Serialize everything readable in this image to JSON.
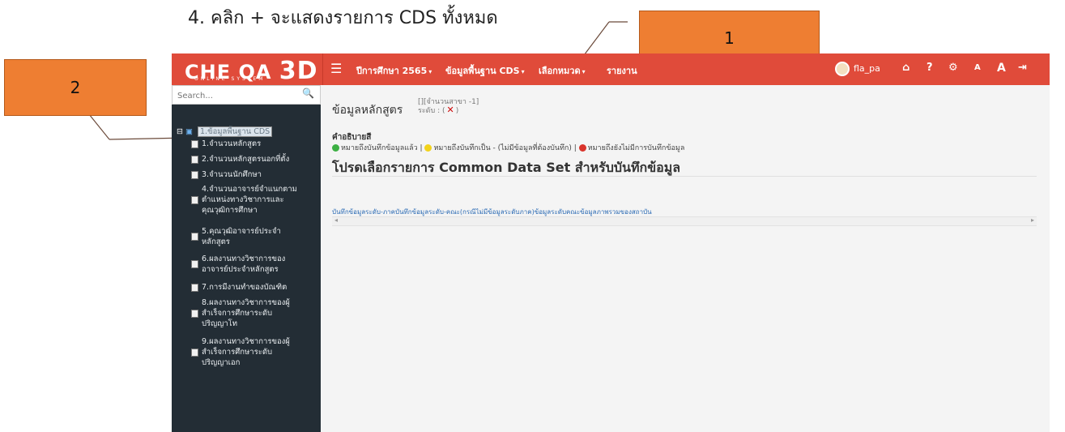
{
  "instruction": "4. คลิก + จะแสดงรายการ CDS ทั้งหมด",
  "callouts": {
    "one": "1",
    "two": "2"
  },
  "header": {
    "logo_main": "CHE QA",
    "logo_3d": "3D",
    "logo_sub": "ONLINE SYSTEM",
    "menu": {
      "year": "ปีการศึกษา 2565",
      "cds": "ข้อมูลพื้นฐาน CDS",
      "category": "เลือกหมวด",
      "report": "รายงาน"
    },
    "username": "fla_pa",
    "icons": [
      "home-icon",
      "help-icon",
      "settings-icon",
      "font-small-icon",
      "font-large-icon",
      "logout-icon"
    ]
  },
  "sidebar": {
    "search_placeholder": "Search...",
    "root_label": "1.ข้อมูลพื้นฐาน CDS",
    "items": [
      "1.จำนวนหลักสูตร",
      "2.จำนวนหลักสูตรนอกที่ตั้ง",
      "3.จำนวนนักศึกษา",
      "4.จำนวนอาจารย์จำแนกตาม\nตำแหน่งทางวิชาการและ\nคุณวุฒิการศึกษา",
      "5.คุณวุฒิอาจารย์ประจำ\nหลักสูตร",
      "6.ผลงานทางวิชาการของ\nอาจารย์ประจำหลักสูตร",
      "7.การมีงานทำของบัณฑิต",
      "8.ผลงานทางวิชาการของผู้\nสำเร็จการศึกษาระดับ\nปริญญาโท",
      "9.ผลงานทางวิชาการของผู้\nสำเร็จการศึกษาระดับ\nปริญญาเอก"
    ]
  },
  "content": {
    "title": "ข้อมูลหลักสูตร",
    "meta_count": "[][จำนวนสาขา -1]",
    "meta_level": "ระดับ : (",
    "meta_level_close": ")",
    "legend_title": "คำอธิบายสี",
    "legend_green": "หมายถึงบันทึกข้อมูลแล้ว |",
    "legend_yellow": "หมายถึงบันทึกเป็น - (ไม่มีข้อมูลที่ต้องบันทึก) |",
    "legend_red": "หมายถึงยังไม่มีการบันทึกข้อมูล",
    "heading": "โปรดเลือกรายการ Common Data Set สำหรับบันทึกข้อมูล",
    "link_row": "บันทึกข้อมูลระดับ-ภาคบันทึกข้อมูลระดับ-คณะ(กรณีไม่มีข้อมูลระดับภาค)ข้อมูลระดับคณะข้อมูลภาพรวมของสถาบัน"
  },
  "colors": {
    "brand_red": "#e04b3a",
    "sidebar_bg": "#232d35",
    "callout_orange": "#ee7e32",
    "green": "#3cb043",
    "yellow": "#f2d21a",
    "red": "#d9342b"
  }
}
